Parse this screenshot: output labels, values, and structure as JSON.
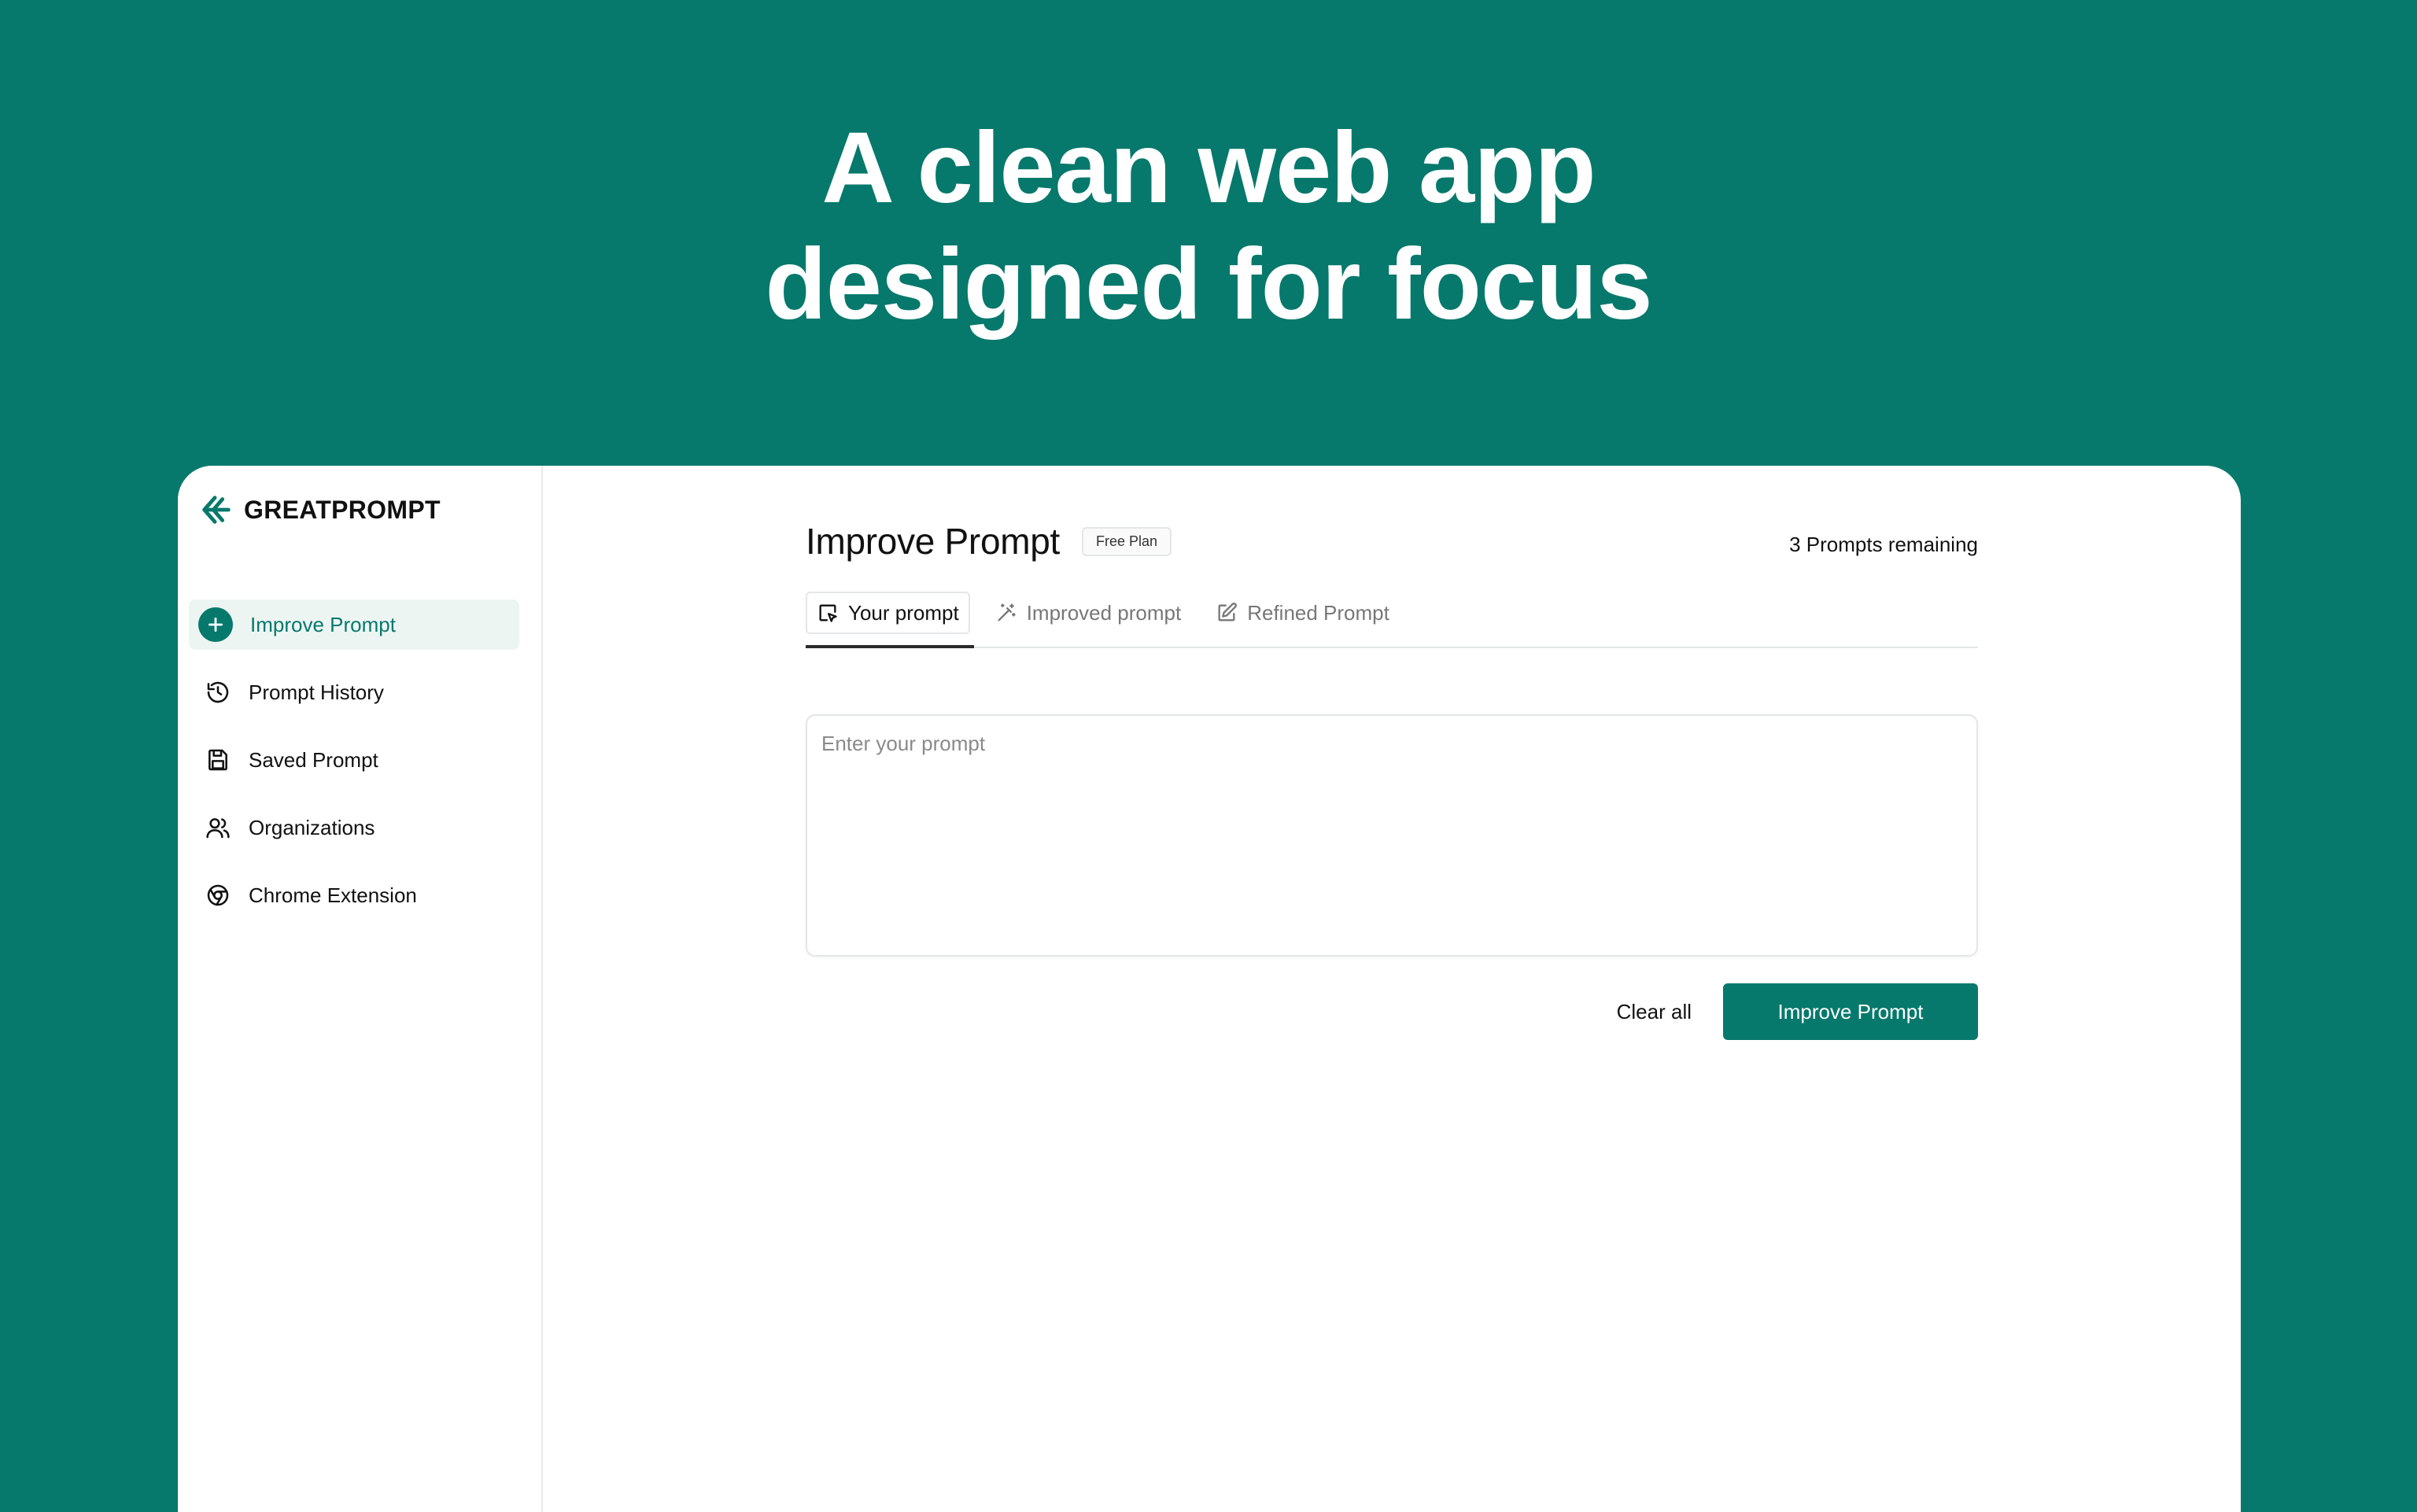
{
  "hero": {
    "line1": "A clean web app",
    "line2": "designed for focus"
  },
  "brand": {
    "name": "GREATPROMPT",
    "logo_icon": "arrow-left-logo-icon",
    "color": "#06796c"
  },
  "sidebar": {
    "items": [
      {
        "label": "Improve Prompt",
        "icon": "plus-circle-icon",
        "active": true
      },
      {
        "label": "Prompt History",
        "icon": "history-icon",
        "active": false
      },
      {
        "label": "Saved Prompt",
        "icon": "floppy-disk-icon",
        "active": false
      },
      {
        "label": "Organizations",
        "icon": "users-icon",
        "active": false
      },
      {
        "label": "Chrome Extension",
        "icon": "chrome-icon",
        "active": false
      }
    ]
  },
  "main": {
    "title": "Improve Prompt",
    "plan_badge": "Free Plan",
    "remaining": "3 Prompts remaining",
    "tabs": [
      {
        "label": "Your prompt",
        "icon": "pointer-square-icon",
        "active": true
      },
      {
        "label": "Improved prompt",
        "icon": "magic-wand-icon",
        "active": false
      },
      {
        "label": "Refined Prompt",
        "icon": "edit-square-icon",
        "active": false
      }
    ],
    "prompt_input": {
      "placeholder": "Enter your prompt",
      "value": ""
    },
    "actions": {
      "clear_label": "Clear all",
      "submit_label": "Improve Prompt"
    }
  },
  "colors": {
    "background": "#06796c",
    "accent": "#06796c",
    "active_nav_bg": "#edf5f3"
  }
}
